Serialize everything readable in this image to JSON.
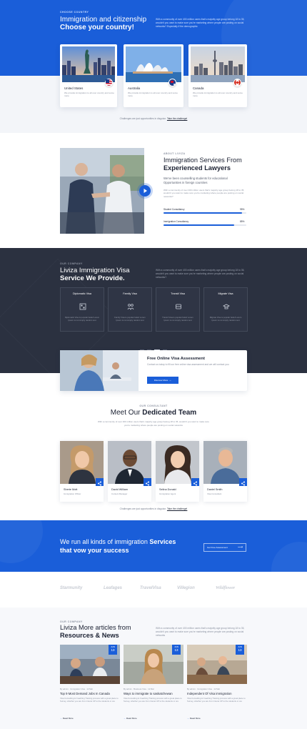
{
  "hero": {
    "eyebrow": "Choose country",
    "title_light": "Immigration and citizenship",
    "title_bold": "Choose your country!",
    "desc": "With a community of over 400 million users that's majority age group belong 18 to 35, wouldn't you want to make sure you're marketing where people are posting on social networks? Especially if the demographic"
  },
  "countries": [
    {
      "name": "United States",
      "desc": "We provide immigration to all over country and some more"
    },
    {
      "name": "Australia",
      "desc": "We provide immigration to all over country and some more"
    },
    {
      "name": "Canada",
      "desc": "We provide immigration to all over country and some more"
    }
  ],
  "country_note": {
    "text": "Challenges are just opportunities in disguise.",
    "link": "Take the challenge!"
  },
  "services": {
    "eyebrow": "About Liviza",
    "title_light": "Immigration Services From",
    "title_bold": "Experienced Lawyers",
    "lead": "We've been counselling students for educational Opportunities in foreign countries",
    "desc": "With a community of over 400 million users that's majority age group belong 18 to 35, wouldn't you want to make sure you're marketing where people are posting on social networks?",
    "bars": [
      {
        "label": "Student Consultancy",
        "value": 95,
        "display": "95%"
      },
      {
        "label": "Immigration Consultancy",
        "value": 85,
        "display": "85%"
      }
    ]
  },
  "visa": {
    "eyebrow": "Our company",
    "title_light": "Liviza Immigration Visa",
    "title_bold": "Service We Provide.",
    "desc": "With a community of over 400 million users that's majority age group belong 18 to 35, wouldn't you want to make sure you're marketing where people are posting on social networks?",
    "cards": [
      {
        "title": "Diplomatic Visa",
        "icon": "diplomatic-visa-icon",
        "desc": "Diplomatic Visa is popular belief Lorem Ipsum is not simply random text"
      },
      {
        "title": "Family Visa",
        "icon": "family-visa-icon",
        "desc": "Family Visa is popular belief Lorem Ipsum is not simply random text"
      },
      {
        "title": "Transit Visa",
        "icon": "transit-visa-icon",
        "desc": "Transit Visa is popular belief Lorem Ipsum is not simply random text"
      },
      {
        "title": "Migrate Visa",
        "icon": "migrate-visa-icon",
        "desc": "Migrate Visa is popular belief Lorem Ipsum is not simply random text"
      }
    ]
  },
  "assessment": {
    "title": "Free Online Visa Assessment",
    "desc": "Contact us today to fill our free online visa assessment and we will contact you",
    "button": "Discover More"
  },
  "team": {
    "eyebrow": "Our consultant",
    "title_light": "Meet Our",
    "title_bold": "Dedicated Team",
    "desc": "With a community of over 400 million users that's majority age group belong 18 to 35, wouldn't you want to make sure you're marketing where people are posting on social networks",
    "members": [
      {
        "name": "Sherie Mott",
        "role": "Immigration Officer"
      },
      {
        "name": "David William",
        "role": "Content Manager"
      },
      {
        "name": "Selina Donald",
        "role": "Immigration Agent"
      },
      {
        "name": "Daniel Smith",
        "role": "Visa Consultant"
      }
    ],
    "note": "Challenges are just opportunities in disguise.",
    "note_link": "Take the challenge!"
  },
  "cta": {
    "title_light": "We run all kinds of immigration",
    "title_bold1": "Services",
    "title_bold2": "that vow your success",
    "button": "Get Free Assessment"
  },
  "partners": [
    "Starmunity",
    "Leafages",
    "TravelVisa",
    "Villegion",
    "Wildflower"
  ],
  "articles": {
    "eyebrow": "Our company",
    "title_light": "Liviza More articles from",
    "title_bold": "Resources & News",
    "desc": "With a community of over 400 million users that's majority age group belong 18 to 35, wouldn't you want to make sure you're marketing where people are posting on social networks",
    "items": [
      {
        "month": "JUN",
        "day": "13",
        "meta": "By admin   ·   Immigration Visa   ·   12 Mar",
        "title": "Top 9 Most Demand Jobs In Canada",
        "desc": "Visa Consulting & Coaching Training process with a great place to Survey, whether you are from Interet UP to the students or ore",
        "more": "Read More"
      },
      {
        "month": "JUN",
        "day": "13",
        "meta": "By admin   ·   Business Visa   ·   12 Mar",
        "title": "Ways to immigrate to saskatchewan",
        "desc": "Visa Consulting & Coaching Training process with a great place to Survey, whether you are from Interet UP to the students or ore",
        "more": "Read More"
      },
      {
        "month": "JUN",
        "day": "13",
        "meta": "By admin   ·   Immigration Visa   ·   12 Mar",
        "title": "Independent Of Visa immigration",
        "desc": "Visa Consulting & Coaching Training process with a great place to Survey, whether you are from Interet UP to the students or ore",
        "more": "Read More"
      }
    ]
  }
}
